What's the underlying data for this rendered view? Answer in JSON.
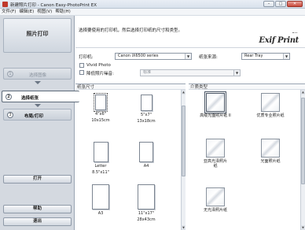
{
  "window": {
    "title": "新建照片打印 - Canon Easy-PhotoPrint EX",
    "minimize": "–",
    "maximize": "□",
    "close": "✕"
  },
  "menu": [
    "文件(F)",
    "编辑(E)",
    "视图(V)",
    "帮助(H)"
  ],
  "left_panel": {
    "title": "照片打印",
    "steps": [
      {
        "num": "1",
        "label": "选择图像",
        "state": "disabled"
      },
      {
        "num": "2",
        "label": "选择纸张",
        "state": "active"
      },
      {
        "num": "3",
        "label": "布局/打印",
        "state": "normal"
      }
    ],
    "open_label": "打开",
    "help_label": "帮助",
    "exit_label": "退出"
  },
  "main": {
    "instruction": "选择要使用的打印机，然后选择打印纸的尺寸和类型。",
    "logo": "Exif Print",
    "printer_label": "打印机:",
    "printer_value": "Canon iX6500 series",
    "paper_source_label": "纸张来源:",
    "paper_source_value": "Rear Tray",
    "vivid_photo_label": "Vivid Photo",
    "noise_label": "降低照片噪音:",
    "noise_value": "标准",
    "paper_size_header": "纸张尺寸",
    "media_type_header": "介质类型",
    "paper_sizes": [
      {
        "name": "4\"x6\"",
        "sub": "10x15cm",
        "selected": true
      },
      {
        "name": "5\"x7\"",
        "sub": "13x18cm",
        "selected": false
      },
      {
        "name": "Letter",
        "sub": "8.5\"x11\"",
        "selected": false
      },
      {
        "name": "A4",
        "sub": "",
        "selected": false
      },
      {
        "name": "A3",
        "sub": "",
        "selected": false
      },
      {
        "name": "11\"x17\"",
        "sub": "28x43cm",
        "selected": false
      }
    ],
    "media_types": [
      {
        "name": "高级光面照片纸 II",
        "selected": true
      },
      {
        "name": "优质专业照片纸",
        "selected": false
      },
      {
        "name": "亚高光泽照片纸",
        "selected": false
      },
      {
        "name": "光面照片纸",
        "selected": false
      },
      {
        "name": "无光泽照片纸",
        "selected": false
      }
    ],
    "dropdown_arrow": "▼",
    "scroll_up": "▲",
    "scroll_down": "▼"
  }
}
